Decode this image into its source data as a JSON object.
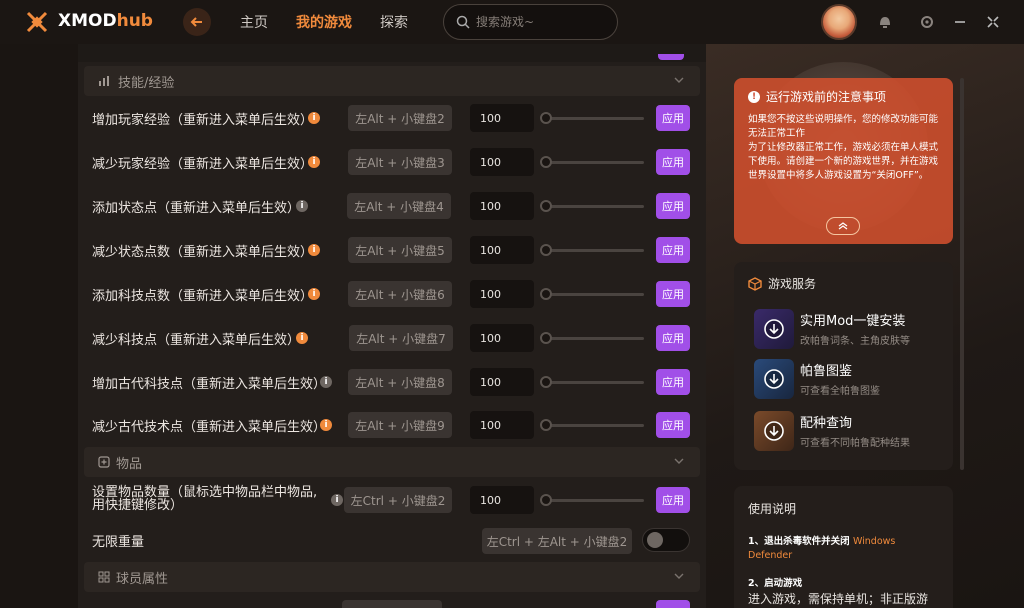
{
  "app": {
    "name_main": "XMOD",
    "name_accent": "hub"
  },
  "nav": {
    "home": "主页",
    "my_games": "我的游戏",
    "explore": "探索"
  },
  "search": {
    "placeholder": "搜索游戏~"
  },
  "colors": {
    "accent": "#f08a3c",
    "apply": "#a14fe8",
    "notice": "#d2502d"
  },
  "sections": {
    "skills": "技能/经验",
    "items": "物品",
    "player_attrs": "球员属性"
  },
  "rows": [
    {
      "label": "增加玩家经验（重新进入菜单后生效）",
      "hotkey": "左Alt + 小键盘2",
      "value": "100",
      "apply": "应用"
    },
    {
      "label": "减少玩家经验（重新进入菜单后生效）",
      "hotkey": "左Alt + 小键盘3",
      "value": "100",
      "apply": "应用"
    },
    {
      "label": "添加状态点（重新进入菜单后生效）",
      "hotkey": "左Alt + 小键盘4",
      "value": "100",
      "apply": "应用"
    },
    {
      "label": "减少状态点数（重新进入菜单后生效）",
      "hotkey": "左Alt + 小键盘5",
      "value": "100",
      "apply": "应用"
    },
    {
      "label": "添加科技点数（重新进入菜单后生效）",
      "hotkey": "左Alt + 小键盘6",
      "value": "100",
      "apply": "应用"
    },
    {
      "label": "减少科技点（重新进入菜单后生效）",
      "hotkey": "左Alt + 小键盘7",
      "value": "100",
      "apply": "应用"
    },
    {
      "label": "增加古代科技点（重新进入菜单后生效）",
      "hotkey": "左Alt + 小键盘8",
      "value": "100",
      "apply": "应用"
    },
    {
      "label": "减少古代技术点（重新进入菜单后生效）",
      "hotkey": "左Alt + 小键盘9",
      "value": "100",
      "apply": "应用"
    }
  ],
  "item_rows": {
    "set_qty": {
      "label_1": "设置物品数量（鼠标选中物品栏中物品,",
      "label_2": "用快捷键修改）",
      "hotkey": "左Ctrl + 小键盘2",
      "value": "100",
      "apply": "应用"
    },
    "no_weight": {
      "label": "无限重量",
      "hotkey": "左Ctrl + 左Alt + 小键盘2"
    }
  },
  "notice": {
    "title": "运行游戏前的注意事项",
    "line1": "如果您不按这些说明操作，您的修改功能可能无法正常工作",
    "line2": "为了让修改器正常工作，游戏必须在单人模式下使用。请创建一个新的游戏世界，并在游戏世界设置中将多人游戏设置为“关闭OFF”。"
  },
  "services": {
    "title": "游戏服务",
    "items": [
      {
        "name": "实用Mod一键安装",
        "desc": "改帕鲁词条、主角皮肤等"
      },
      {
        "name": "帕鲁图鉴",
        "desc": "可查看全帕鲁图鉴"
      },
      {
        "name": "配种查询",
        "desc": "可查看不同帕鲁配种结果"
      }
    ]
  },
  "usage": {
    "title": "使用说明",
    "step1": "1、退出杀毒软件并关闭",
    "step1_hl": "Windows Defender",
    "step2": "2、启动游戏",
    "step2_sub": "进入游戏，需保持单机；非正版游"
  }
}
